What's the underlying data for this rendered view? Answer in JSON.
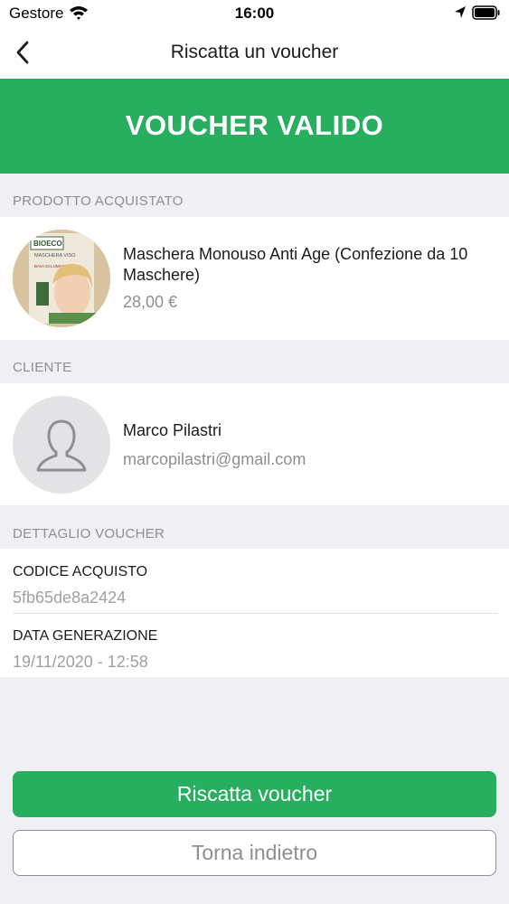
{
  "status_bar": {
    "carrier": "Gestore",
    "time": "16:00"
  },
  "nav": {
    "title": "Riscatta un voucher"
  },
  "banner": {
    "text": "VOUCHER VALIDO"
  },
  "product_section": {
    "header": "PRODOTTO ACQUISTATO",
    "name": "Maschera Monouso Anti Age (Confezione da 10 Maschere)",
    "price": "28,00 €",
    "image_label_top": "BIOECO",
    "image_label_mid": "MASCHERA VISO",
    "image_label_bottom": "BAVA DI LUMACA"
  },
  "client_section": {
    "header": "CLIENTE",
    "name": "Marco Pilastri",
    "email": "marcopilastri@gmail.com"
  },
  "voucher_section": {
    "header": "DETTAGLIO VOUCHER",
    "code_label": "CODICE ACQUISTO",
    "code_value": "5fb65de8a2424",
    "date_label": "DATA GENERAZIONE",
    "date_value": "19/11/2020 - 12:58"
  },
  "actions": {
    "redeem_label": "Riscatta voucher",
    "back_label": "Torna indietro"
  },
  "colors": {
    "accent": "#27ae5f",
    "background": "#efeff4",
    "secondary_text": "#8e8e93"
  }
}
